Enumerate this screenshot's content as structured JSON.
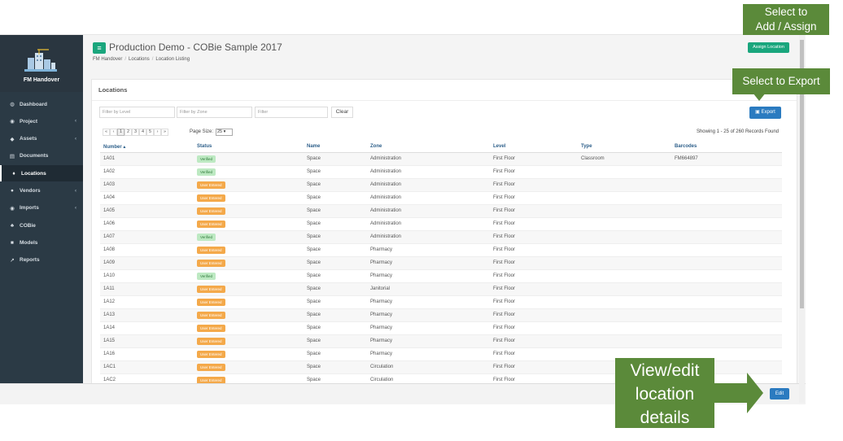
{
  "app": {
    "logo_text": "FM Handover",
    "page_title": "Production Demo - COBie Sample 2017",
    "breadcrumb": [
      "FM Handover",
      "Locations",
      "Location Listing"
    ],
    "assign_label": "Assign Location"
  },
  "sidebar": {
    "items": [
      {
        "label": "Dashboard",
        "icon": "dashboard-icon",
        "glyph": "◍",
        "chev": ""
      },
      {
        "label": "Project",
        "icon": "project-icon",
        "glyph": "◉",
        "chev": "‹"
      },
      {
        "label": "Assets",
        "icon": "assets-icon",
        "glyph": "◆",
        "chev": "‹"
      },
      {
        "label": "Documents",
        "icon": "documents-icon",
        "glyph": "▤",
        "chev": ""
      },
      {
        "label": "Locations",
        "icon": "location-pin-icon",
        "glyph": "♦",
        "chev": ""
      },
      {
        "label": "Vendors",
        "icon": "vendors-icon",
        "glyph": "●",
        "chev": "‹"
      },
      {
        "label": "Imports",
        "icon": "imports-icon",
        "glyph": "◉",
        "chev": "‹"
      },
      {
        "label": "COBie",
        "icon": "cobie-icon",
        "glyph": "♣",
        "chev": ""
      },
      {
        "label": "Models",
        "icon": "models-icon",
        "glyph": "■",
        "chev": ""
      },
      {
        "label": "Reports",
        "icon": "reports-icon",
        "glyph": "↗",
        "chev": ""
      }
    ]
  },
  "panel": {
    "title": "Locations",
    "filters": {
      "level_placeholder": "Filter by Level",
      "zone_placeholder": "Filter by Zone",
      "generic_placeholder": "Filter"
    },
    "clear_label": "Clear",
    "export_label": "Export",
    "pager": {
      "first": "«",
      "prev": "‹",
      "pages": [
        "1",
        "2",
        "3",
        "4",
        "5"
      ],
      "next": "›",
      "last": "»",
      "page_size_label": "Page Size:",
      "page_size": "25 ▾"
    },
    "records_info": "Showing 1 - 25 of 260 Records Found"
  },
  "table": {
    "columns": [
      "Number ▴",
      "Status",
      "Name",
      "Zone",
      "Level",
      "Type",
      "Barcodes"
    ],
    "rows": [
      {
        "number": "1A01",
        "status": "Verified",
        "name": "Space",
        "zone": "Administration",
        "level": "First Floor",
        "type": "Classroom",
        "barcode": "FM664897"
      },
      {
        "number": "1A02",
        "status": "Verified",
        "name": "Space",
        "zone": "Administration",
        "level": "First Floor",
        "type": "",
        "barcode": ""
      },
      {
        "number": "1A03",
        "status": "User Entered",
        "name": "Space",
        "zone": "Administration",
        "level": "First Floor",
        "type": "",
        "barcode": ""
      },
      {
        "number": "1A04",
        "status": "User Entered",
        "name": "Space",
        "zone": "Administration",
        "level": "First Floor",
        "type": "",
        "barcode": ""
      },
      {
        "number": "1A05",
        "status": "User Entered",
        "name": "Space",
        "zone": "Administration",
        "level": "First Floor",
        "type": "",
        "barcode": ""
      },
      {
        "number": "1A06",
        "status": "User Entered",
        "name": "Space",
        "zone": "Administration",
        "level": "First Floor",
        "type": "",
        "barcode": ""
      },
      {
        "number": "1A07",
        "status": "Verified",
        "name": "Space",
        "zone": "Administration",
        "level": "First Floor",
        "type": "",
        "barcode": ""
      },
      {
        "number": "1A08",
        "status": "User Entered",
        "name": "Space",
        "zone": "Pharmacy",
        "level": "First Floor",
        "type": "",
        "barcode": ""
      },
      {
        "number": "1A09",
        "status": "User Entered",
        "name": "Space",
        "zone": "Pharmacy",
        "level": "First Floor",
        "type": "",
        "barcode": ""
      },
      {
        "number": "1A10",
        "status": "Verified",
        "name": "Space",
        "zone": "Pharmacy",
        "level": "First Floor",
        "type": "",
        "barcode": ""
      },
      {
        "number": "1A11",
        "status": "User Entered",
        "name": "Space",
        "zone": "Janitorial",
        "level": "First Floor",
        "type": "",
        "barcode": ""
      },
      {
        "number": "1A12",
        "status": "User Entered",
        "name": "Space",
        "zone": "Pharmacy",
        "level": "First Floor",
        "type": "",
        "barcode": ""
      },
      {
        "number": "1A13",
        "status": "User Entered",
        "name": "Space",
        "zone": "Pharmacy",
        "level": "First Floor",
        "type": "",
        "barcode": ""
      },
      {
        "number": "1A14",
        "status": "User Entered",
        "name": "Space",
        "zone": "Pharmacy",
        "level": "First Floor",
        "type": "",
        "barcode": ""
      },
      {
        "number": "1A15",
        "status": "User Entered",
        "name": "Space",
        "zone": "Pharmacy",
        "level": "First Floor",
        "type": "",
        "barcode": ""
      },
      {
        "number": "1A16",
        "status": "User Entered",
        "name": "Space",
        "zone": "Pharmacy",
        "level": "First Floor",
        "type": "",
        "barcode": ""
      },
      {
        "number": "1AC1",
        "status": "User Entered",
        "name": "Space",
        "zone": "Circulation",
        "level": "First Floor",
        "type": "",
        "barcode": ""
      },
      {
        "number": "1AC2",
        "status": "User Entered",
        "name": "Space",
        "zone": "Circulation",
        "level": "First Floor",
        "type": "",
        "barcode": ""
      }
    ]
  },
  "edit_label": "Edit",
  "callouts": {
    "assign": [
      "Select to",
      "Add / Assign"
    ],
    "export": "Select to Export",
    "edit": [
      "View/edit",
      "location",
      "details"
    ]
  },
  "colors": {
    "sidebar_bg": "#2b3a45",
    "accent_green": "#1aa67d",
    "accent_blue": "#2b7bc0",
    "callout_green": "#5b8a3a",
    "badge_verified": "#bde9c2",
    "badge_user": "#f4a94a"
  }
}
